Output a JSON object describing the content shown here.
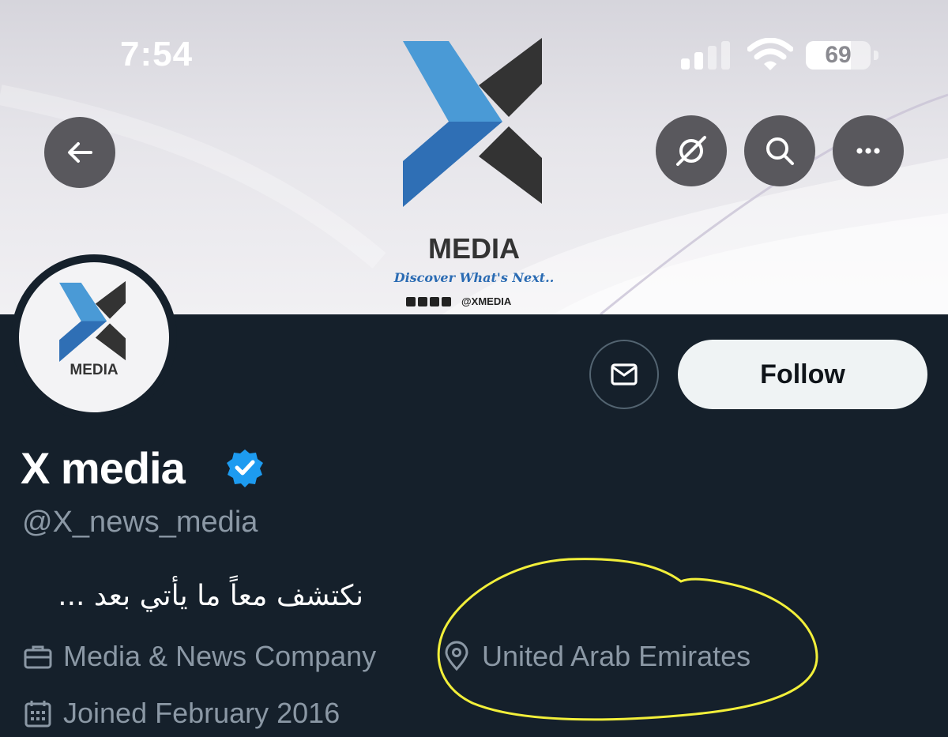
{
  "status_bar": {
    "time": "7:54",
    "battery_level": "69",
    "battery_fraction": 0.69
  },
  "banner": {
    "logo_word": "MEDIA",
    "logo_tagline": "Discover What's Next..",
    "logo_handle": "@XMEDIA"
  },
  "nav": {
    "back_icon": "arrow-left-icon",
    "grok_icon": "slash-circle-icon",
    "search_icon": "search-icon",
    "more_icon": "more-horizontal-icon"
  },
  "avatar": {
    "word": "MEDIA"
  },
  "actions": {
    "message_icon": "envelope-icon",
    "follow_label": "Follow"
  },
  "profile": {
    "display_name": "X media",
    "handle": "@X_news_media",
    "bio": "نكتشف معاً ما يأتي بعد ...",
    "category": "Media & News Company",
    "location": "United Arab Emirates",
    "joined": "Joined February 2016"
  },
  "colors": {
    "background": "#15202b",
    "muted_text": "#8b98a5",
    "verified_blue": "#1d9bf0",
    "follow_bg": "#eff3f4",
    "logo_blue": "#3d8fd1",
    "logo_dark": "#333333",
    "highlight_yellow": "#f2ef3a"
  }
}
